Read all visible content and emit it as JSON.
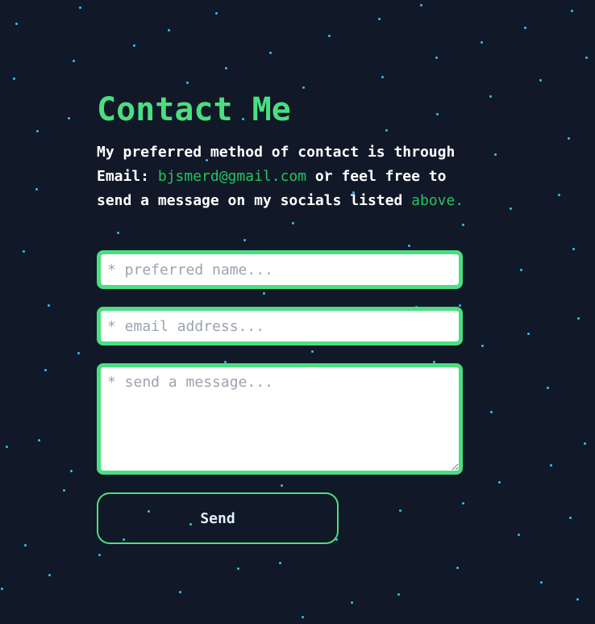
{
  "theme": {
    "background": "#111827",
    "accent": "#4ade80",
    "star_color": "#38bdf8"
  },
  "contact": {
    "title": "Contact Me",
    "intro": {
      "part1": "My preferred method of contact is through Email: ",
      "email": "bjsmerd@gmail.com",
      "part2": " or feel free to send a message on my socials listed ",
      "above": "above."
    },
    "form": {
      "name_placeholder": "* preferred name...",
      "email_placeholder": "* email address...",
      "message_placeholder": "* send a message...",
      "send_label": "Send"
    }
  }
}
